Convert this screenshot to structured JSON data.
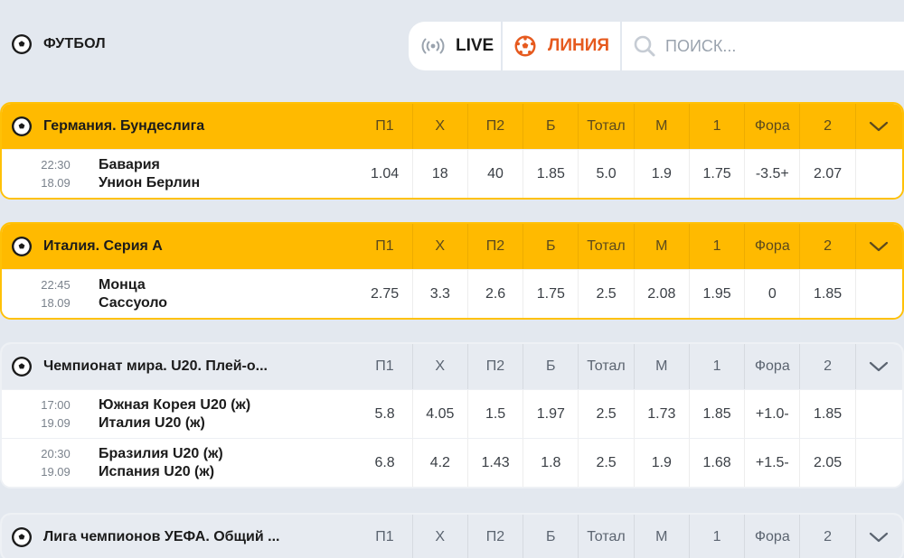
{
  "sport": {
    "title": "ФУТБОЛ",
    "icon": "soccer-ball-icon"
  },
  "switcher": {
    "live_label": "LIVE",
    "line_label": "ЛИНИЯ",
    "search_placeholder": "ПОИСК..."
  },
  "colors": {
    "accent": "#ffba00",
    "line": "#e65a1e",
    "background": "#e3e8ef"
  },
  "columns": [
    "П1",
    "Х",
    "П2",
    "Б",
    "Тотал",
    "М",
    "1",
    "Фора",
    "2"
  ],
  "leagues": [
    {
      "name": "Германия. Бундеслига",
      "highlighted": true,
      "matches": [
        {
          "time": "22:30",
          "date": "18.09",
          "team1": "Бавария",
          "team2": "Унион Берлин",
          "odds": [
            "1.04",
            "18",
            "40",
            "1.85",
            "5.0",
            "1.9",
            "1.75",
            "-3.5+",
            "2.07"
          ]
        }
      ]
    },
    {
      "name": "Италия. Серия А",
      "highlighted": true,
      "matches": [
        {
          "time": "22:45",
          "date": "18.09",
          "team1": "Монца",
          "team2": "Сассуоло",
          "odds": [
            "2.75",
            "3.3",
            "2.6",
            "1.75",
            "2.5",
            "2.08",
            "1.95",
            "0",
            "1.85"
          ]
        }
      ]
    },
    {
      "name": "Чемпионат мира. U20. Плей-о...",
      "highlighted": false,
      "matches": [
        {
          "time": "17:00",
          "date": "19.09",
          "team1": "Южная Корея U20 (ж)",
          "team2": "Италия U20 (ж)",
          "odds": [
            "5.8",
            "4.05",
            "1.5",
            "1.97",
            "2.5",
            "1.73",
            "1.85",
            "+1.0-",
            "1.85"
          ]
        },
        {
          "time": "20:30",
          "date": "19.09",
          "team1": "Бразилия U20 (ж)",
          "team2": "Испания U20 (ж)",
          "odds": [
            "6.8",
            "4.2",
            "1.43",
            "1.8",
            "2.5",
            "1.9",
            "1.68",
            "+1.5-",
            "2.05"
          ]
        }
      ]
    },
    {
      "name": "Лига чемпионов УЕФА. Общий ...",
      "highlighted": false,
      "matches": []
    }
  ]
}
